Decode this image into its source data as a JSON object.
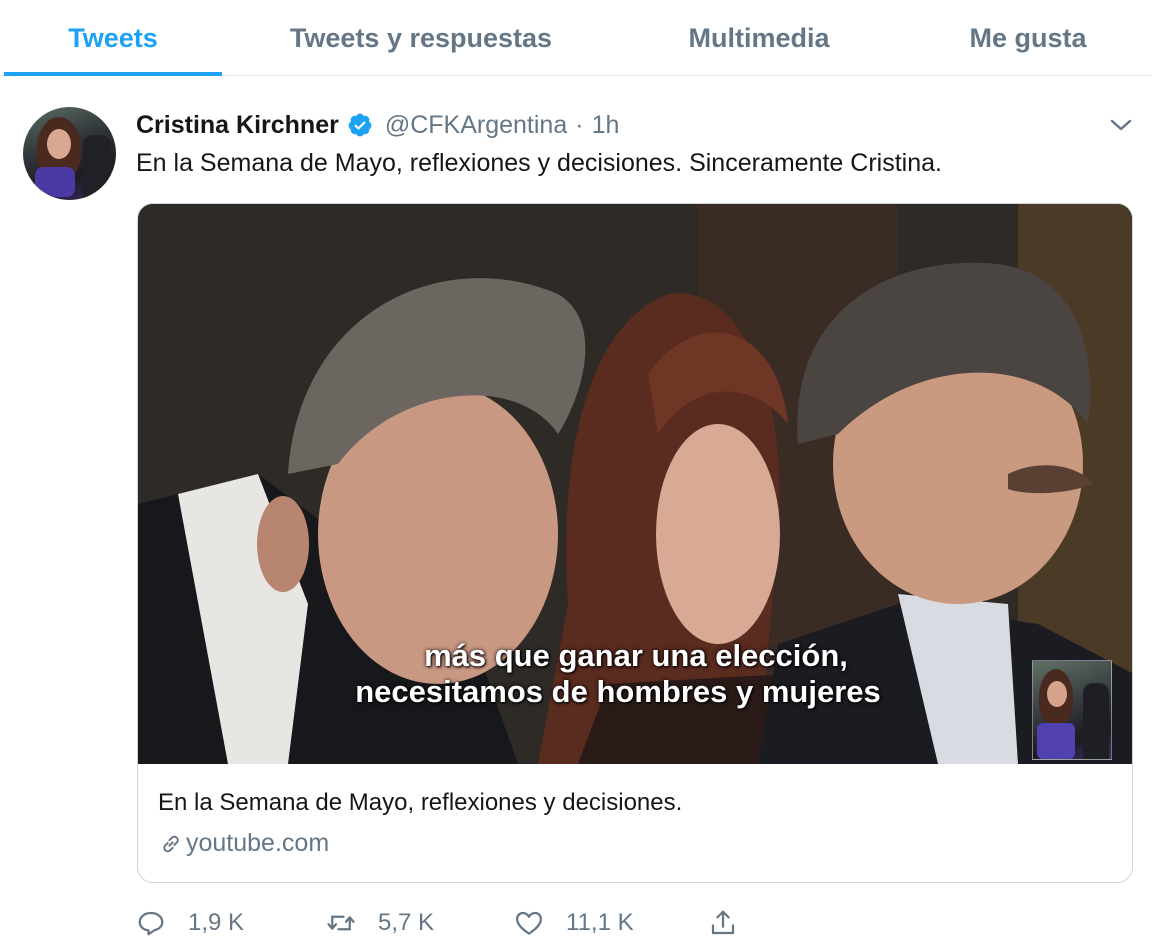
{
  "tabs": [
    {
      "label": "Tweets",
      "active": true
    },
    {
      "label": "Tweets y respuestas",
      "active": false
    },
    {
      "label": "Multimedia",
      "active": false
    },
    {
      "label": "Me gusta",
      "active": false
    }
  ],
  "tweet": {
    "author_name": "Cristina Kirchner",
    "verified": true,
    "handle": "@CFKArgentina",
    "separator": "·",
    "time": "1h",
    "text": "En la Semana de Mayo, reflexiones y decisiones. Sinceramente Cristina.",
    "card": {
      "subtitle_line1": "más que ganar una elección,",
      "subtitle_line2": "necesitamos de hombres y mujeres",
      "title": "En la Semana de Mayo, reflexiones y decisiones.",
      "domain": "youtube.com"
    },
    "actions": {
      "replies": "1,9 K",
      "retweets": "5,7 K",
      "likes": "11,1 K"
    }
  },
  "colors": {
    "accent": "#1da1f2",
    "secondary_text": "#657786",
    "border": "#e6ecf0"
  },
  "icons": [
    "verified-badge-icon",
    "chevron-down-icon",
    "link-icon",
    "reply-icon",
    "retweet-icon",
    "like-icon",
    "share-icon"
  ]
}
